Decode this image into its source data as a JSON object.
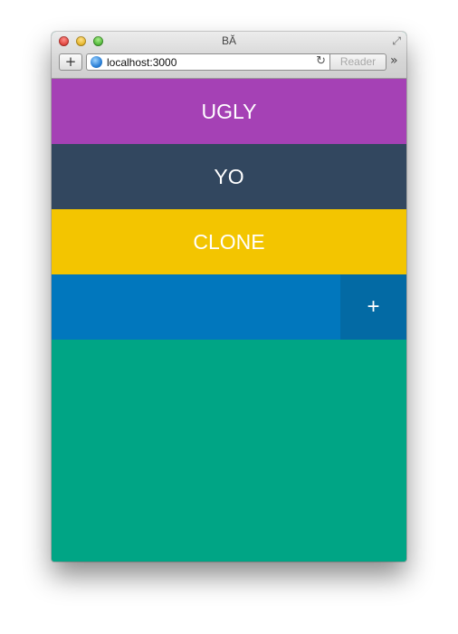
{
  "window": {
    "title": "BĂ"
  },
  "toolbar": {
    "new_tab_label": "+",
    "url": "localhost:3000",
    "reader_label": "Reader",
    "more_label": "»"
  },
  "list": {
    "items": [
      {
        "label": "UGLY",
        "color": "#a541b5"
      },
      {
        "label": "YO",
        "color": "#32475f"
      },
      {
        "label": "CLONE",
        "color": "#f3c500"
      }
    ]
  },
  "new_item": {
    "input_value": "",
    "add_label": "+",
    "input_color": "#0177bd",
    "button_color": "#036aa4"
  },
  "background_color": "#00a585"
}
